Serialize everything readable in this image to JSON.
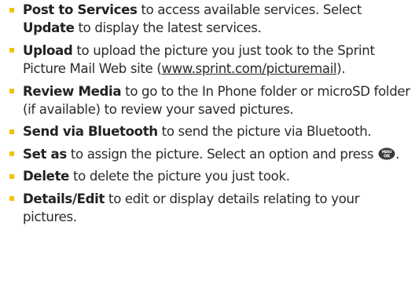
{
  "items": [
    {
      "keyword": "Post to Services",
      "text1": " to access available services. Select ",
      "keyword2": "Update",
      "text2": " to display the latest services."
    },
    {
      "keyword": "Upload",
      "text1": " to upload the picture you just took to the Sprint Picture Mail Web site (",
      "link": "www.sprint.com/picturemail",
      "text2": ")."
    },
    {
      "keyword": "Review Media",
      "text1": " to go to the In Phone folder or microSD folder (if available) to review your saved pictures."
    },
    {
      "keyword": "Send via Bluetooth",
      "text1": " to send the picture via Bluetooth."
    },
    {
      "keyword": "Set as",
      "text1": " to assign the picture. Select an option and press ",
      "icon": "menu-ok-key-icon",
      "icon_label_top": "MENU",
      "icon_label_bottom": "OK",
      "text2": "."
    },
    {
      "keyword": "Delete",
      "text1": " to delete the picture you just took."
    },
    {
      "keyword": "Details/Edit",
      "text1": " to edit or display details relating to your pictures."
    }
  ],
  "colors": {
    "bullet": "#f2c200",
    "text": "#2a2a2a",
    "key_icon": "#3a3a3a"
  }
}
